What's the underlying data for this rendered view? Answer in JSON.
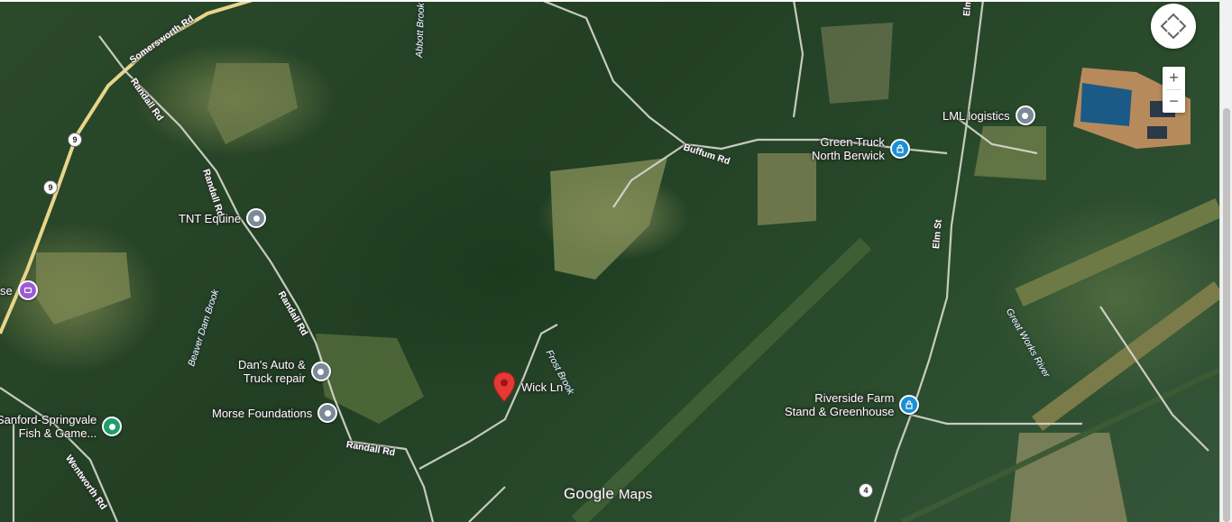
{
  "map": {
    "branding": {
      "google": "Google",
      "maps": "Maps"
    },
    "roads": [
      {
        "name": "somersworth-rd",
        "label": "Somersworth Rd"
      },
      {
        "name": "randall-rd-1",
        "label": "Randall Rd"
      },
      {
        "name": "randall-rd-2",
        "label": "Randall Rd"
      },
      {
        "name": "randall-rd-3",
        "label": "Randall Rd"
      },
      {
        "name": "randall-rd-4",
        "label": "Randall Rd"
      },
      {
        "name": "buffum-rd",
        "label": "Buffum Rd"
      },
      {
        "name": "elm-st-1",
        "label": "Elm St"
      },
      {
        "name": "elm-st-2",
        "label": "Elm"
      },
      {
        "name": "wentworth-rd",
        "label": "Wentworth Rd"
      }
    ],
    "waterways": [
      {
        "name": "abbott-brook",
        "label": "Abbott Brook"
      },
      {
        "name": "beaver-dam-brook",
        "label": "Beaver Dam Brook"
      },
      {
        "name": "frost-brook",
        "label": "Frost Brook"
      },
      {
        "name": "great-works-river",
        "label": "Great Works River"
      }
    ],
    "route_badges": [
      "9",
      "9",
      "4"
    ],
    "places": [
      {
        "name": "tnt-equine",
        "label": "TNT Equine",
        "type": "generic",
        "color": "#7a8a99"
      },
      {
        "name": "dans-auto",
        "label": "Dan's Auto &\nTruck repair",
        "type": "generic",
        "color": "#7a8a99"
      },
      {
        "name": "morse-foundations",
        "label": "Morse Foundations",
        "type": "generic",
        "color": "#7a8a99"
      },
      {
        "name": "lml-logistics",
        "label": "LML logistics",
        "type": "generic",
        "color": "#7a8a99"
      },
      {
        "name": "green-truck",
        "label": "Green Truck\nNorth Berwick",
        "type": "shopping",
        "color": "#1a8fd6"
      },
      {
        "name": "riverside-farm",
        "label": "Riverside Farm\nStand & Greenhouse",
        "type": "shopping",
        "color": "#1a8fd6"
      },
      {
        "name": "sanford-springvale",
        "label": "Sanford-Springvale\nFish & Game...",
        "type": "recreation",
        "color": "#1e9e6a"
      },
      {
        "name": "partial-se",
        "label": "se",
        "type": "entertainment",
        "color": "#9c5cd6"
      }
    ],
    "selected_place": {
      "label": "Wick Ln",
      "marker_color": "#e53935"
    },
    "controls": {
      "zoom_in": "+",
      "zoom_out": "−"
    }
  }
}
